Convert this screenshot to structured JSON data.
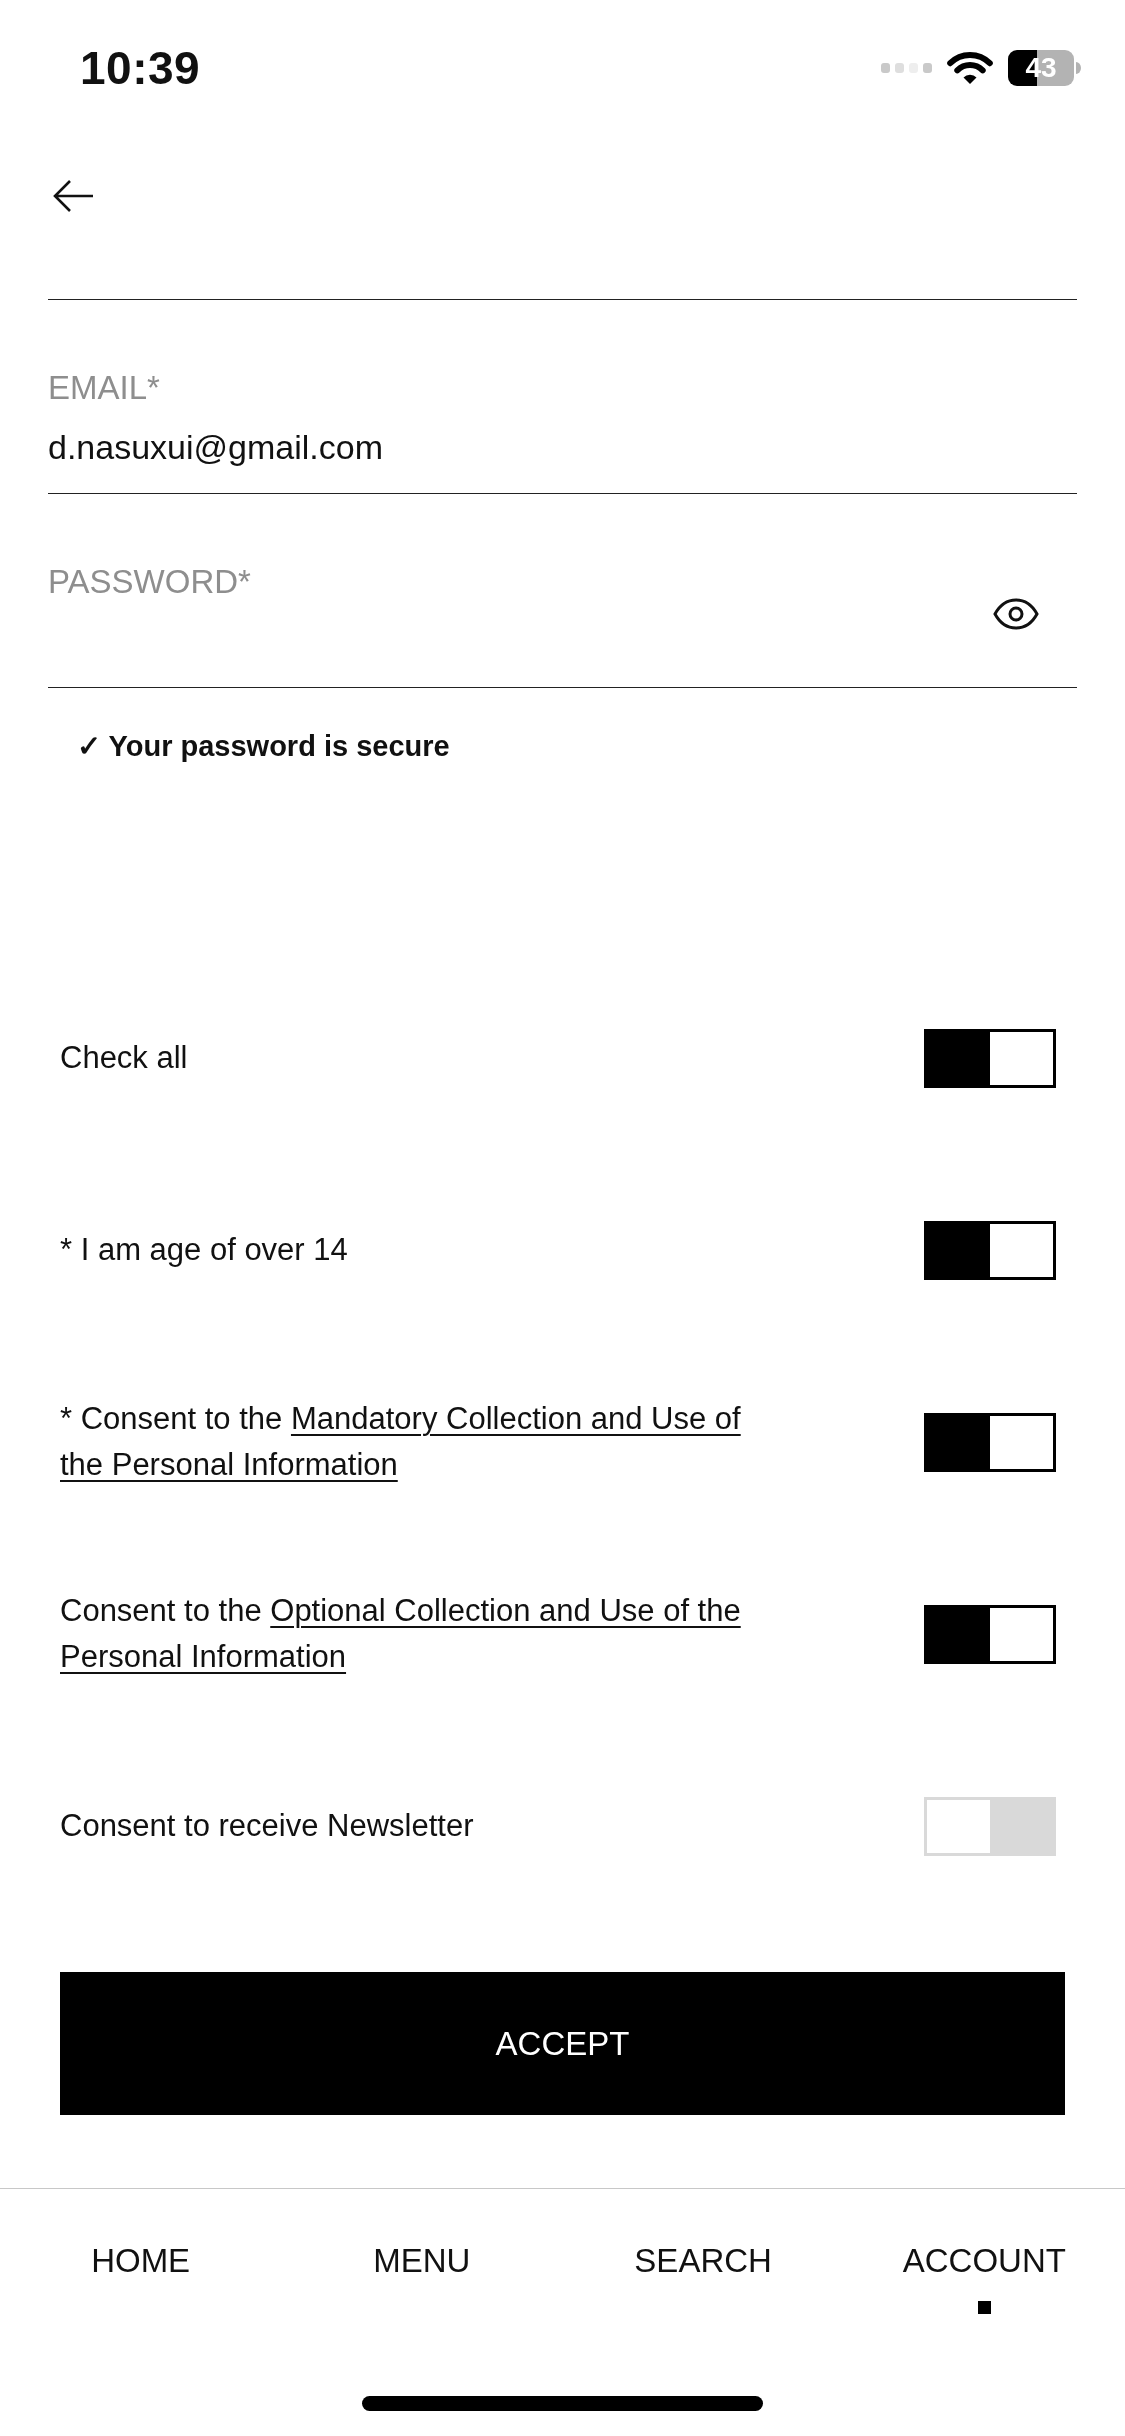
{
  "status_bar": {
    "time": "10:39",
    "battery": "43"
  },
  "fields": [
    {
      "kind": "text",
      "label": "EMAIL*",
      "value": "d.nasuxui@gmail.com"
    },
    {
      "kind": "password",
      "label": "PASSWORD*"
    }
  ],
  "password_status": "✓ Your password is secure",
  "consents": [
    {
      "kind": "plain",
      "label": "Check all",
      "on": true
    },
    {
      "kind": "plain",
      "label": "* I am age of over 14",
      "on": true
    },
    {
      "kind": "link",
      "label": "* Consent to the",
      "link_lines": [
        "Mandatory Collection and Use of",
        "the Personal Information"
      ],
      "on": true
    },
    {
      "kind": "link",
      "label": "Consent to the",
      "link_lines": [
        "Optional Collection and Use of the",
        "Personal Information"
      ],
      "on": true
    },
    {
      "kind": "plain",
      "label": "Consent to receive Newsletter",
      "on": false
    }
  ],
  "accept_button": "ACCEPT",
  "nav": [
    {
      "label": "HOME",
      "selected": false
    },
    {
      "label": "MENU",
      "selected": false
    },
    {
      "label": "SEARCH",
      "selected": false
    },
    {
      "label": "ACCOUNT",
      "selected": true
    }
  ]
}
